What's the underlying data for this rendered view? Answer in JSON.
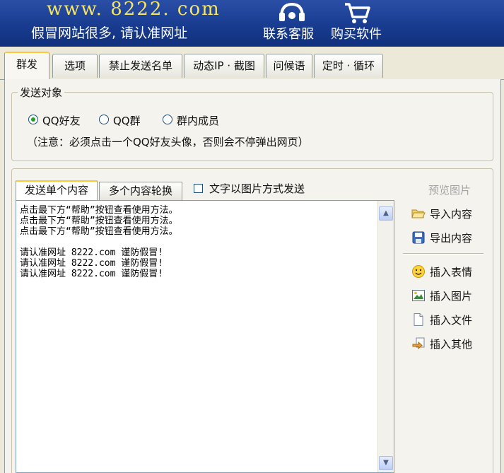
{
  "header": {
    "site_url": "www. 8222. com",
    "slogan": "假冒网站很多, 请认准网址",
    "buttons": [
      {
        "label": "联系客服",
        "icon": "headset-icon"
      },
      {
        "label": "购买软件",
        "icon": "cart-icon"
      }
    ]
  },
  "tabs": [
    "群发",
    "选项",
    "禁止发送名单",
    "动态IP · 截图",
    "问候语",
    "定时 · 循环"
  ],
  "active_tab": "群发",
  "send_target": {
    "legend": "发送对象",
    "options": [
      "QQ好友",
      "QQ群",
      "群内成员"
    ],
    "selected": "QQ好友",
    "note": "（注意：必须点击一个QQ好友头像，否则会不停弹出网页）"
  },
  "content": {
    "tabs": [
      "发送单个内容",
      "多个内容轮换"
    ],
    "active_tab": "发送单个内容",
    "image_mode_label": "文字以图片方式发送",
    "image_mode_checked": false,
    "editor_lines": [
      "点击最下方“帮助”按钮查看使用方法。",
      "点击最下方“帮助”按钮查看使用方法。",
      "点击最下方“帮助”按钮查看使用方法。",
      "",
      "请认准网址 8222.com 谨防假冒!",
      "请认准网址 8222.com 谨防假冒!",
      "请认准网址 8222.com 谨防假冒!"
    ]
  },
  "side_panel": {
    "preview_label": "预览图片",
    "actions": [
      {
        "label": "导入内容",
        "icon": "folder-open-icon"
      },
      {
        "label": "导出内容",
        "icon": "save-disk-icon"
      },
      {
        "label": "插入表情",
        "icon": "smiley-icon"
      },
      {
        "label": "插入图片",
        "icon": "picture-icon"
      },
      {
        "label": "插入文件",
        "icon": "file-icon"
      },
      {
        "label": "插入其他",
        "icon": "insert-arrow-icon"
      }
    ]
  },
  "colors": {
    "header_bg": "#173a8e",
    "url_text": "#f3e46a",
    "active_tab_accent": "#ffc83c",
    "window_bg": "#ece9d8"
  }
}
